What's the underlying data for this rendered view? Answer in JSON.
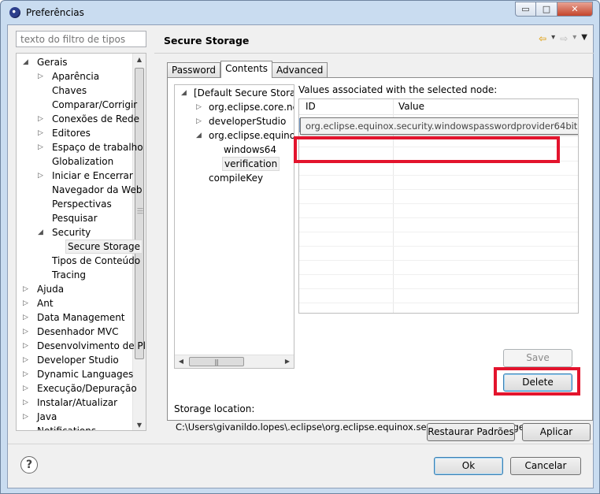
{
  "window": {
    "title": "Preferências"
  },
  "filter": {
    "placeholder": "texto do filtro de tipos"
  },
  "tree": [
    {
      "label": "Gerais",
      "expander": "◢",
      "indent": 0
    },
    {
      "label": "Aparência",
      "expander": "▷",
      "indent": 1
    },
    {
      "label": "Chaves",
      "expander": "",
      "indent": 1
    },
    {
      "label": "Comparar/Corrigir",
      "expander": "",
      "indent": 1
    },
    {
      "label": "Conexões de Rede",
      "expander": "▷",
      "indent": 1
    },
    {
      "label": "Editores",
      "expander": "▷",
      "indent": 1
    },
    {
      "label": "Espaço de trabalho",
      "expander": "▷",
      "indent": 1
    },
    {
      "label": "Globalization",
      "expander": "",
      "indent": 1
    },
    {
      "label": "Iniciar e Encerrar",
      "expander": "▷",
      "indent": 1
    },
    {
      "label": "Navegador da Web",
      "expander": "",
      "indent": 1
    },
    {
      "label": "Perspectivas",
      "expander": "",
      "indent": 1
    },
    {
      "label": "Pesquisar",
      "expander": "",
      "indent": 1
    },
    {
      "label": "Security",
      "expander": "◢",
      "indent": 1
    },
    {
      "label": "Secure Storage",
      "expander": "",
      "indent": 2,
      "selected": true
    },
    {
      "label": "Tipos de Conteúdo",
      "expander": "",
      "indent": 1
    },
    {
      "label": "Tracing",
      "expander": "",
      "indent": 1
    },
    {
      "label": "Ajuda",
      "expander": "▷",
      "indent": 0
    },
    {
      "label": "Ant",
      "expander": "▷",
      "indent": 0
    },
    {
      "label": "Data Management",
      "expander": "▷",
      "indent": 0
    },
    {
      "label": "Desenhador MVC",
      "expander": "▷",
      "indent": 0
    },
    {
      "label": "Desenvolvimento de Plu",
      "expander": "▷",
      "indent": 0
    },
    {
      "label": "Developer Studio",
      "expander": "▷",
      "indent": 0
    },
    {
      "label": "Dynamic Languages",
      "expander": "▷",
      "indent": 0
    },
    {
      "label": "Execução/Depuração",
      "expander": "▷",
      "indent": 0
    },
    {
      "label": "Instalar/Atualizar",
      "expander": "▷",
      "indent": 0
    },
    {
      "label": "Java",
      "expander": "▷",
      "indent": 0
    },
    {
      "label": "Notifications",
      "expander": "",
      "indent": 0
    }
  ],
  "page": {
    "title": "Secure Storage",
    "tabs": [
      "Password",
      "Contents",
      "Advanced"
    ],
    "active_tab": 1
  },
  "nodes": [
    {
      "label": "[Default Secure Storage]",
      "expander": "◢",
      "indent": 0
    },
    {
      "label": "org.eclipse.core.net",
      "expander": "▷",
      "indent": 1
    },
    {
      "label": "developerStudio",
      "expander": "▷",
      "indent": 1
    },
    {
      "label": "org.eclipse.equinox.",
      "expander": "◢",
      "indent": 1
    },
    {
      "label": "windows64",
      "expander": "",
      "indent": 2
    },
    {
      "label": "verification",
      "expander": "",
      "indent": 2,
      "selected": true
    },
    {
      "label": "compileKey",
      "expander": "",
      "indent": 1
    }
  ],
  "values": {
    "label": "Values associated with the selected node:",
    "columns": [
      "ID",
      "Value"
    ],
    "tooltip": "org.eclipse.equinox.security.windowspasswordprovider64bit"
  },
  "buttons": {
    "save": "Save",
    "delete": "Delete",
    "restore": "Restaurar Padrões",
    "apply": "Aplicar",
    "ok": "Ok",
    "cancel": "Cancelar",
    "help": "?"
  },
  "storage": {
    "label": "Storage location:",
    "path": "C:\\Users\\givanildo.lopes\\.eclipse\\org.eclipse.equinox.security\\secure_storage"
  },
  "caption": {
    "minimize": "▭",
    "maximize": "□",
    "close": "✕"
  },
  "nav": {
    "back": "⇦",
    "forward": "⇨",
    "menu": "▼",
    "dropdown": "▾"
  },
  "colors": {
    "highlight_box": "#e3142d",
    "selection": "#e6f0fa"
  }
}
